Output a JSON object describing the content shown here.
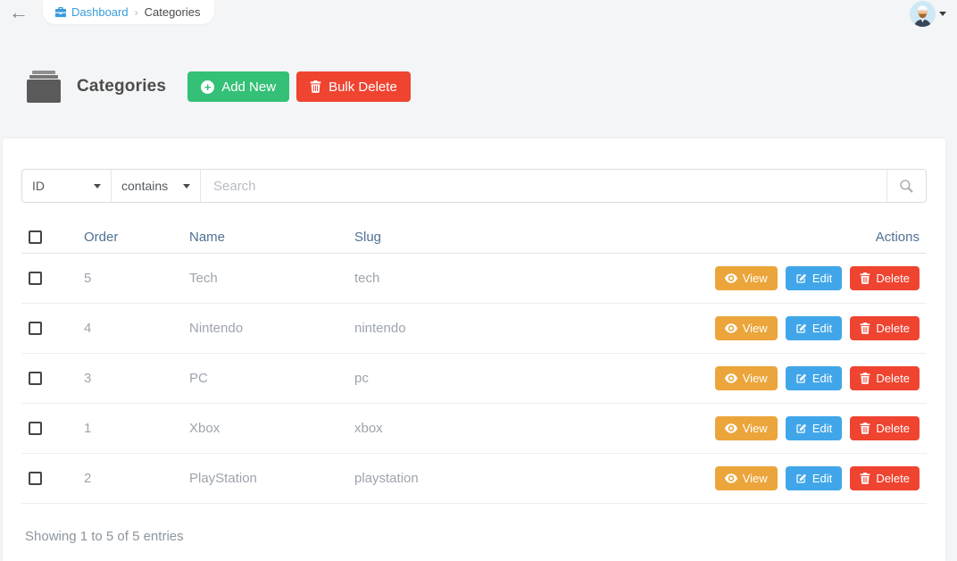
{
  "topbar": {
    "breadcrumb": {
      "dashboard_label": "Dashboard",
      "separator": "›",
      "current": "Categories"
    }
  },
  "header": {
    "title": "Categories",
    "add_new_label": "Add New",
    "bulk_delete_label": "Bulk Delete"
  },
  "filter": {
    "field_value": "ID",
    "operator_value": "contains",
    "search_placeholder": "Search"
  },
  "table": {
    "headers": {
      "order": "Order",
      "name": "Name",
      "slug": "Slug",
      "actions": "Actions"
    },
    "action_labels": {
      "view": "View",
      "edit": "Edit",
      "delete": "Delete"
    },
    "rows": [
      {
        "order": "5",
        "name": "Tech",
        "slug": "tech"
      },
      {
        "order": "4",
        "name": "Nintendo",
        "slug": "nintendo"
      },
      {
        "order": "3",
        "name": "PC",
        "slug": "pc"
      },
      {
        "order": "1",
        "name": "Xbox",
        "slug": "xbox"
      },
      {
        "order": "2",
        "name": "PlayStation",
        "slug": "playstation"
      }
    ]
  },
  "footer": {
    "summary": "Showing 1 to 5 of 5 entries"
  },
  "colors": {
    "accent_green": "#34c076",
    "accent_red": "#ef4430",
    "accent_orange": "#eba53b",
    "accent_blue": "#41a6e9",
    "link_blue": "#3a9cdb",
    "table_header_text": "#4e7193"
  }
}
